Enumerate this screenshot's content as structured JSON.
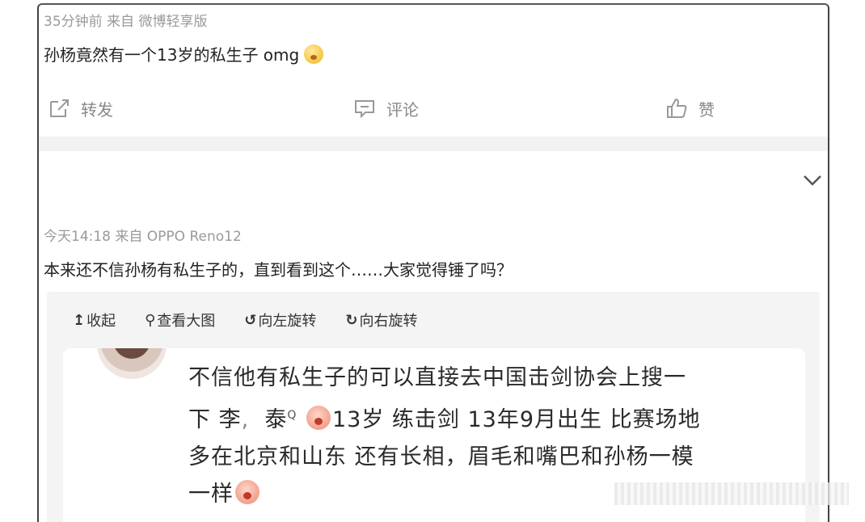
{
  "post1": {
    "meta": "35分钟前  来自 微博轻享版",
    "text": "孙杨竟然有一个13岁的私生子 omg",
    "emoji": "face-emoji",
    "actions": {
      "repost": "转发",
      "comment": "评论",
      "like": "赞"
    }
  },
  "post2": {
    "meta": "今天14:18  来自 OPPO Reno12",
    "text": "本来还不信孙杨有私生子的，直到看到这个……大家觉得锤了吗？",
    "image_toolbar": {
      "collapse": "收起",
      "view_large": "查看大图",
      "rotate_left": "向左旋转",
      "rotate_right": "向右旋转"
    },
    "screenshot_lines": [
      "不信他有私生子的可以直接去中国击剑协会上搜一",
      "下 李",
      "泰",
      "13岁 练击剑 13年9月出生 比赛场地",
      "多在北京和山东 还有长相，眉毛和嘴巴和孙杨一模",
      "一样"
    ]
  }
}
